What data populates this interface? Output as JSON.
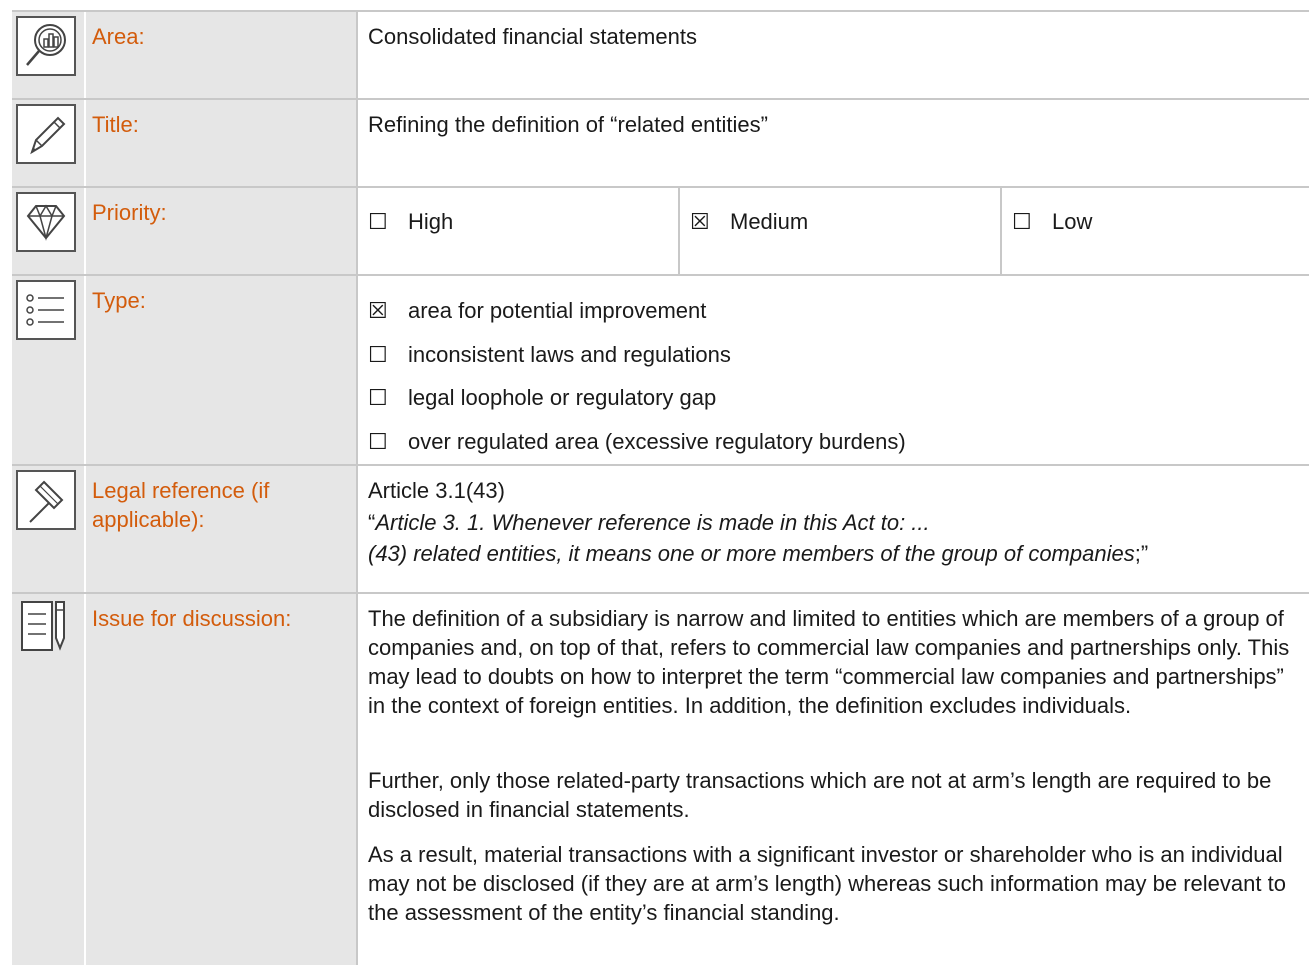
{
  "rows": {
    "area": {
      "label": "Area:",
      "value": "Consolidated financial statements"
    },
    "title": {
      "label": "Title:",
      "value": "Refining the definition of “related entities”"
    },
    "priority": {
      "label": "Priority:",
      "options": [
        {
          "box": "☐",
          "label": "High"
        },
        {
          "box": "☒",
          "label": "Medium"
        },
        {
          "box": "☐",
          "label": "Low"
        }
      ]
    },
    "type": {
      "label": "Type:",
      "options": [
        {
          "box": "☒",
          "label": "area for potential improvement"
        },
        {
          "box": "☐",
          "label": "inconsistent laws and regulations"
        },
        {
          "box": "☐",
          "label": "legal loophole or regulatory gap"
        },
        {
          "box": "☐",
          "label": "over regulated area (excessive regulatory burdens)"
        }
      ]
    },
    "legal": {
      "label": "Legal reference (if applicable):",
      "reference": "Article 3.1(43)",
      "quote_open": "“",
      "quote_line1": "Article 3. 1. Whenever reference is made in this Act to: ...",
      "quote_line2": "(43) related entities, it means one or more members of the group of companies",
      "quote_close": ";”"
    },
    "issue": {
      "label": "Issue for discussion:",
      "paragraphs": [
        "The definition of a subsidiary is narrow and limited to entities which are members of a group of companies and, on top of that, refers to commercial law companies and partnerships only. This may lead to doubts on how to interpret the term “commercial law companies and partnerships” in the context of foreign entities. In addition, the definition excludes individuals.",
        "Further, only those related-party transactions which are not at arm’s length are required to be disclosed in financial statements.",
        "As a result, material transactions with a significant investor or shareholder who is an individual may not be disclosed (if they are at arm’s length) whereas such information may be relevant to the assessment of the entity’s financial standing."
      ]
    }
  },
  "icons": [
    "magnifier-chart-icon",
    "pencil-icon",
    "diamond-icon",
    "list-icon",
    "gavel-icon",
    "document-pen-icon"
  ],
  "colors": {
    "label": "#d35c0c",
    "cell_bg": "#e6e6e6",
    "border": "#c8c8c8",
    "text": "#1a1a1a"
  }
}
